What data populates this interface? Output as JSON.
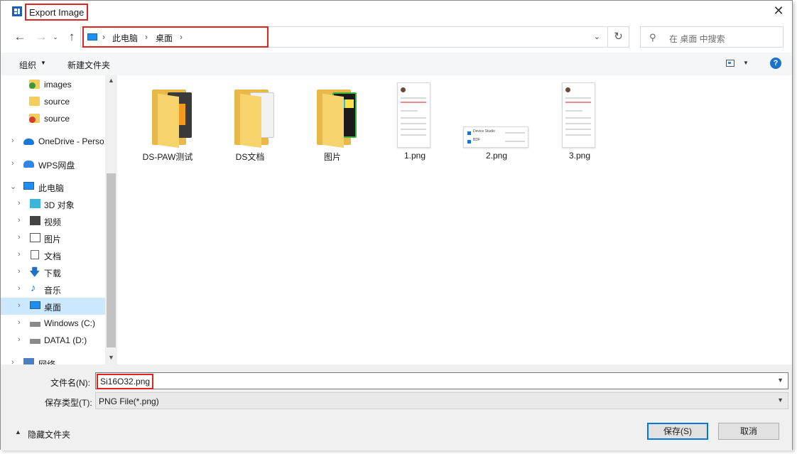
{
  "window": {
    "title": "Export Image",
    "close_glyph": "✕"
  },
  "nav": {
    "back_glyph": "←",
    "forward_glyph": "→",
    "recent_glyph": "⌄",
    "up_glyph": "↑",
    "breadcrumbs": [
      "此电脑",
      "桌面"
    ],
    "separator": "›",
    "refresh_glyph": "↻",
    "search_placeholder": "在 桌面 中搜索"
  },
  "toolbar": {
    "organize_label": "组织",
    "new_folder_label": "新建文件夹",
    "help_label": "?"
  },
  "sidebar": {
    "items": [
      {
        "label": "images",
        "icon": "folder-check-icon"
      },
      {
        "label": "source",
        "icon": "folder-icon"
      },
      {
        "label": "source",
        "icon": "folder-error-icon"
      },
      {
        "label": "OneDrive - Perso",
        "icon": "onedrive-icon"
      },
      {
        "label": "WPS网盘",
        "icon": "wps-cloud-icon"
      },
      {
        "label": "此电脑",
        "icon": "this-pc-icon"
      },
      {
        "label": "3D 对象",
        "icon": "3d-objects-icon"
      },
      {
        "label": "视频",
        "icon": "video-icon"
      },
      {
        "label": "图片",
        "icon": "pictures-icon"
      },
      {
        "label": "文档",
        "icon": "documents-icon"
      },
      {
        "label": "下载",
        "icon": "download-icon"
      },
      {
        "label": "音乐",
        "icon": "music-icon"
      },
      {
        "label": "桌面",
        "icon": "desktop-icon"
      },
      {
        "label": "Windows (C:)",
        "icon": "drive-c-icon"
      },
      {
        "label": "DATA1 (D:)",
        "icon": "drive-d-icon"
      },
      {
        "label": "网络",
        "icon": "network-icon"
      }
    ]
  },
  "files": [
    {
      "label": "DS-PAW测试",
      "kind": "folder"
    },
    {
      "label": "DS文档",
      "kind": "folder"
    },
    {
      "label": "图片",
      "kind": "folder"
    },
    {
      "label": "1.png",
      "kind": "image"
    },
    {
      "label": "2.png",
      "kind": "image"
    },
    {
      "label": "3.png",
      "kind": "image"
    }
  ],
  "thumb_text": {
    "device_studio": "Device Studio",
    "bdf": "BDF"
  },
  "bottom": {
    "filename_label": "文件名(N):",
    "filename_value": "Si16O32.png",
    "filetype_label": "保存类型(T):",
    "filetype_value": "PNG File(*.png)",
    "hide_folders_label": "隐藏文件夹",
    "save_label": "保存(S)",
    "cancel_label": "取消"
  },
  "colors": {
    "accent": "#0078d7",
    "highlight": "#e02424",
    "selected": "#cce8ff"
  }
}
